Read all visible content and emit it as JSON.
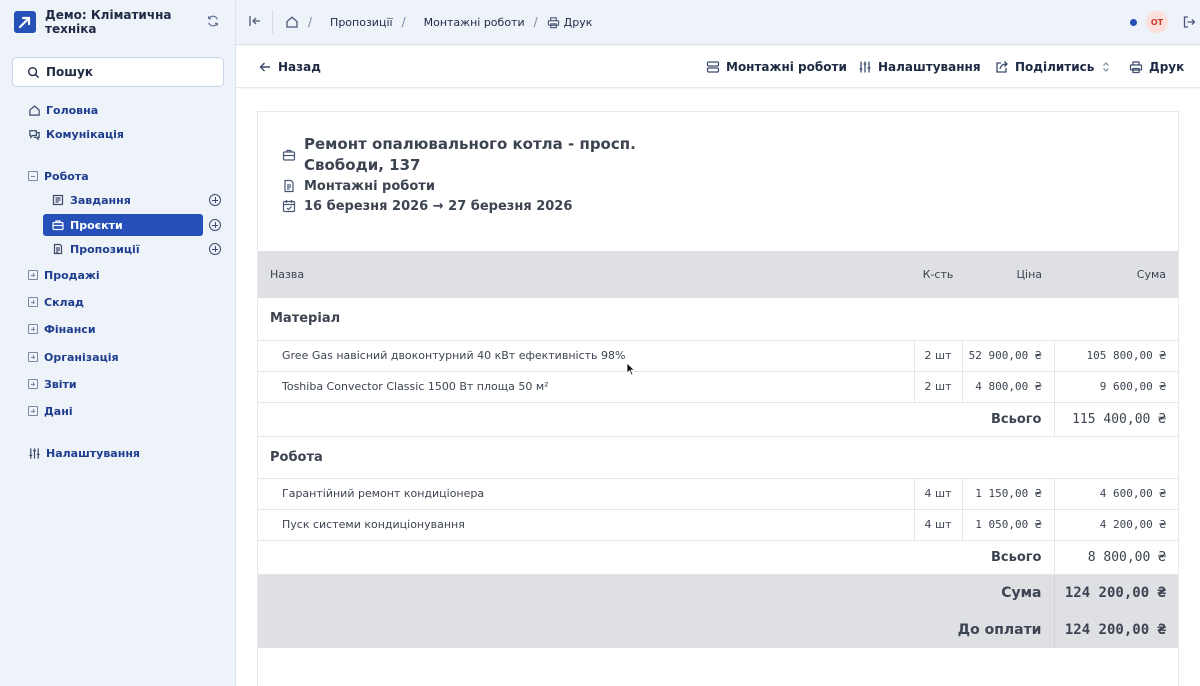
{
  "brand": {
    "title": "Демо: Кліматична техніка",
    "accent": "#2450b8"
  },
  "sidebar": {
    "search_label": "Пошук",
    "top_items": [
      {
        "label": "Головна",
        "icon": "home-icon"
      },
      {
        "label": "Комунікація",
        "icon": "chat-icon"
      }
    ],
    "work": {
      "label": "Робота",
      "expanded": true,
      "children": [
        {
          "label": "Завдання",
          "icon": "tasks-icon"
        },
        {
          "label": "Проєкти",
          "icon": "briefcase-icon",
          "active": true
        },
        {
          "label": "Пропозиції",
          "icon": "document-icon"
        }
      ]
    },
    "collapsed_groups": [
      "Продажі",
      "Склад",
      "Фінанси",
      "Організація",
      "Звіти",
      "Дані"
    ],
    "settings_label": "Налаштування"
  },
  "topbar": {
    "breadcrumbs": [
      "Пропозиції",
      "Монтажні роботи",
      "Друк"
    ],
    "avatar_initials": "ОТ"
  },
  "toolbar": {
    "back_label": "Назад",
    "view_label": "Монтажні роботи",
    "settings_label": "Налаштування",
    "share_label": "Поділитись",
    "print_label": "Друк"
  },
  "document": {
    "title": "Ремонт опалювального котла - просп. Свободи, 137",
    "subtitle": "Монтажні роботи",
    "dates": "16 березня 2026 → 27 березня 2026",
    "columns": {
      "name": "Назва",
      "qty": "К-сть",
      "price": "Ціна",
      "sum": "Сума"
    },
    "groups": [
      {
        "name": "Матеріал",
        "lines": [
          {
            "name": "Gree Gas навісний двоконтурний 40 кВт ефективність 98%",
            "qty": "2 шт",
            "price": "52 900,00 ₴",
            "sum": "105 800,00 ₴"
          },
          {
            "name": "Toshiba Convector Classic 1500 Вт площа 50 м²",
            "qty": "2 шт",
            "price": "4 800,00 ₴",
            "sum": "9 600,00 ₴"
          }
        ],
        "total_label": "Всього",
        "total": "115 400,00 ₴"
      },
      {
        "name": "Робота",
        "lines": [
          {
            "name": "Гарантійний ремонт кондиціонера",
            "qty": "4 шт",
            "price": "1 150,00 ₴",
            "sum": "4 600,00 ₴"
          },
          {
            "name": "Пуск системи кондиціонування",
            "qty": "4 шт",
            "price": "1 050,00 ₴",
            "sum": "4 200,00 ₴"
          }
        ],
        "total_label": "Всього",
        "total": "8 800,00 ₴"
      }
    ],
    "sum_label": "Сума",
    "sum_value": "124 200,00 ₴",
    "due_label": "До оплати",
    "due_value": "124 200,00 ₴"
  }
}
